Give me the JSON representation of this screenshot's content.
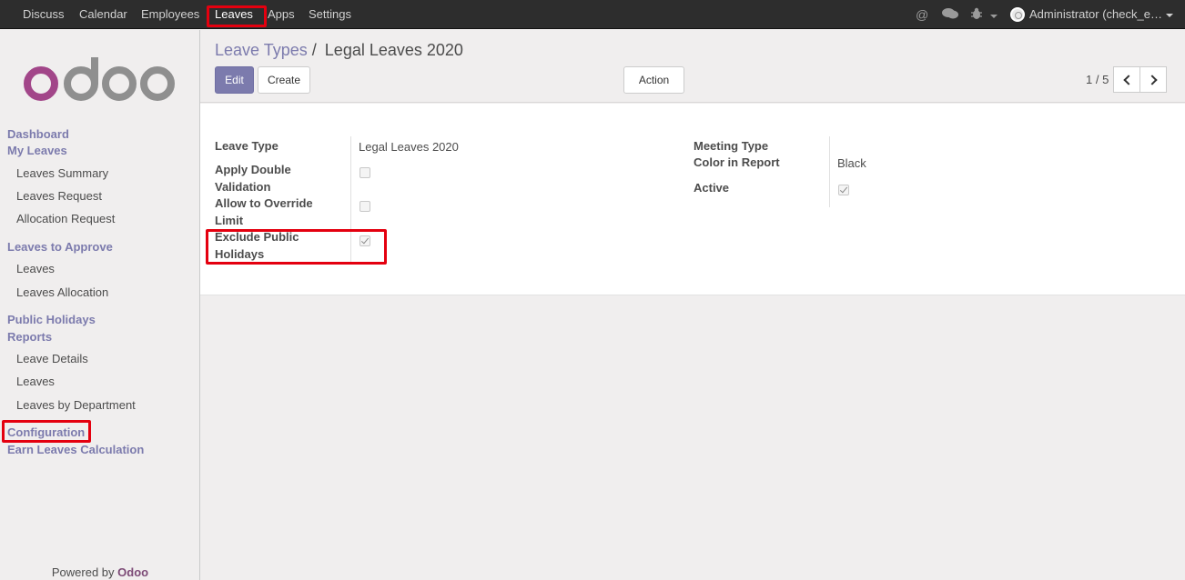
{
  "topbar": {
    "menus": [
      "Discuss",
      "Calendar",
      "Employees",
      "Leaves",
      "Apps",
      "Settings"
    ],
    "active_menu": "Leaves",
    "icons": [
      "at-icon",
      "chat-icon",
      "bug-icon"
    ],
    "user": "Administrator (check_e…"
  },
  "sidebar": {
    "logo": "odoo",
    "sections": [
      {
        "heading": "Dashboard",
        "items": []
      },
      {
        "heading": "My Leaves",
        "items": [
          "Leaves Summary",
          "Leaves Request",
          "Allocation Request"
        ]
      },
      {
        "heading": "Leaves to Approve",
        "items": [
          "Leaves",
          "Leaves Allocation"
        ]
      },
      {
        "heading": "Public Holidays",
        "items": []
      },
      {
        "heading": "Reports",
        "items": [
          "Leave Details",
          "Leaves",
          "Leaves by Department"
        ]
      },
      {
        "heading": "Configuration",
        "items": []
      },
      {
        "heading": "Earn Leaves Calculation",
        "items": []
      }
    ],
    "powered_by": "Powered by",
    "powered_brand": "Odoo"
  },
  "control_panel": {
    "breadcrumb_parent": "Leave Types",
    "breadcrumb_sep": "/",
    "breadcrumb_current": "Legal Leaves 2020",
    "edit_label": "Edit",
    "create_label": "Create",
    "action_label": "Action",
    "pager": "1 / 5"
  },
  "form": {
    "fields_left": [
      {
        "label": "Leave Type",
        "value": "Legal Leaves 2020"
      },
      {
        "label": "Apply Double Validation",
        "checked": false
      },
      {
        "label": "Allow to Override Limit",
        "checked": false
      },
      {
        "label": "Exclude Public Holidays",
        "checked": true
      }
    ],
    "fields_right": [
      {
        "label": "Meeting Type",
        "value": ""
      },
      {
        "label": "Color in Report",
        "value": "Black"
      },
      {
        "label": "Active",
        "checked": true
      }
    ]
  },
  "colors": {
    "brand": "#7c7bad",
    "highlight": "#e4000f",
    "topbar": "#2d2d2d"
  }
}
